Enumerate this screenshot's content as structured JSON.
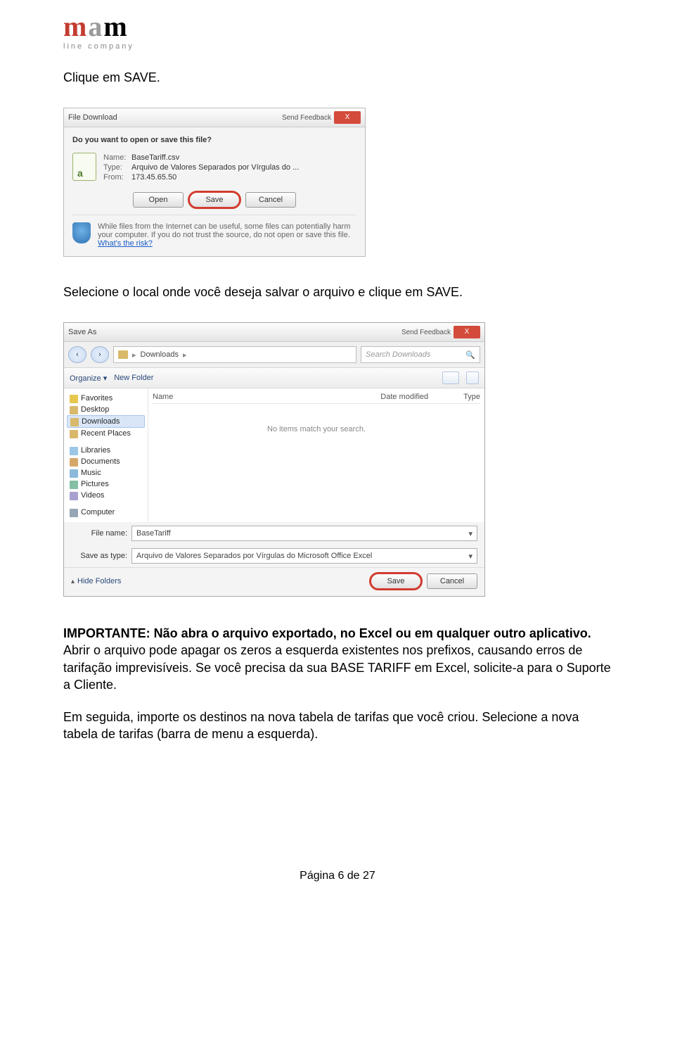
{
  "logo": {
    "m1": "m",
    "a": "a",
    "m2": "m",
    "sub": "line company"
  },
  "p1": "Clique em SAVE.",
  "dl": {
    "title": "File Download",
    "feedback": "Send Feedback",
    "close": "X",
    "question": "Do you want to open or save this file?",
    "name_k": "Name:",
    "name_v": "BaseTariff.csv",
    "type_k": "Type:",
    "type_v": "Arquivo de Valores Separados por Vírgulas do ...",
    "from_k": "From:",
    "from_v": "173.45.65.50",
    "btn_open": "Open",
    "btn_save": "Save",
    "btn_cancel": "Cancel",
    "warn": "While files from the Internet can be useful, some files can potentially harm your computer. If you do not trust the source, do not open or save this file. ",
    "warn_link": "What's the risk?"
  },
  "p2": "Selecione o local onde você deseja salvar o arquivo e clique em SAVE.",
  "save": {
    "title": "Save As",
    "feedback": "Send Feedback",
    "close": "X",
    "nav_back": "‹",
    "nav_fwd": "›",
    "crumb": "Downloads",
    "crumb_sep": "▸",
    "search_ph": "Search Downloads",
    "tb_organize": "Organize ▾",
    "tb_newfolder": "New Folder",
    "side": {
      "fav": "Favorites",
      "desktop": "Desktop",
      "downloads": "Downloads",
      "recent": "Recent Places",
      "lib": "Libraries",
      "docs": "Documents",
      "music": "Music",
      "pics": "Pictures",
      "vids": "Videos",
      "comp": "Computer"
    },
    "cols": {
      "name": "Name",
      "date": "Date modified",
      "type": "Type"
    },
    "empty": "No items match your search.",
    "fname_k": "File name:",
    "fname_v": "BaseTariff",
    "ftype_k": "Save as type:",
    "ftype_v": "Arquivo de Valores Separados por Vírgulas do Microsoft Office Excel",
    "hide": "Hide Folders",
    "btn_save": "Save",
    "btn_cancel": "Cancel"
  },
  "p3a": "IMPORTANTE: Não abra o arquivo exportado, no Excel ou em qualquer outro aplicativo.",
  "p3b": " Abrir o arquivo pode apagar os zeros a esquerda existentes nos prefixos, causando erros de tarifação imprevisíveis. Se você precisa da sua BASE TARIFF em Excel, solicite-a para o Suporte a Cliente.",
  "p4": "Em seguida, importe os destinos na nova tabela de tarifas que você criou. Selecione a nova tabela de tarifas (barra de menu a esquerda).",
  "footer": "Página 6 de 27"
}
